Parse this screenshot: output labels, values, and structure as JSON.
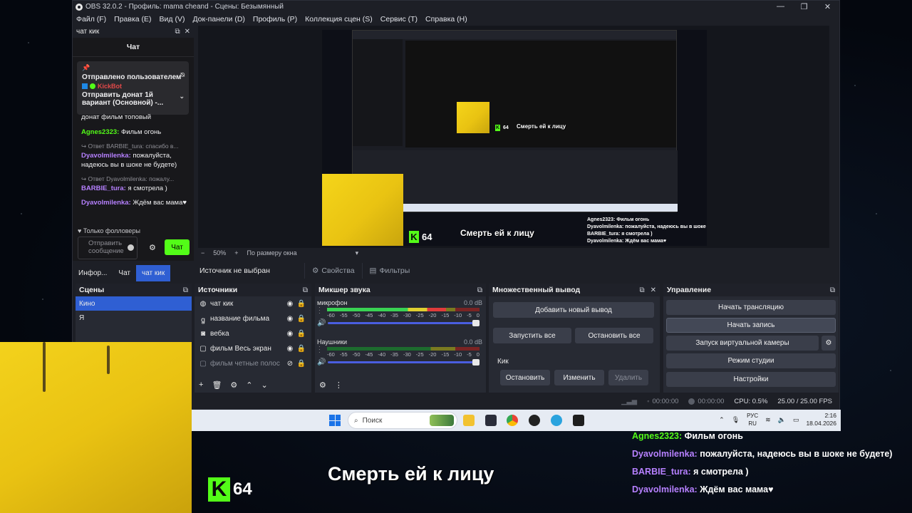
{
  "window": {
    "title": "OBS 32.0.2 - Профиль: mama cheand - Сцены: Безымянный",
    "controls": [
      "—",
      "❐",
      "✕"
    ]
  },
  "menu": [
    "Файл (F)",
    "Правка (E)",
    "Вид (V)",
    "Док-панели (D)",
    "Профиль (P)",
    "Коллекция сцен (S)",
    "Сервис (T)",
    "Справка (H)"
  ],
  "chat_dock": {
    "title": "чат кик",
    "header": "Чат",
    "pinned": {
      "by": "Отправлено пользователем",
      "user": "KickBot",
      "text1": "Отправить донат 1й",
      "text2": "вариант (Основной) -..."
    },
    "messages": [
      {
        "reply": "",
        "user": "",
        "text": "донат фильм топовый",
        "color": "none"
      },
      {
        "reply": "",
        "user": "Agnes2323:",
        "text": "Фильм огонь",
        "color": "green"
      },
      {
        "reply": "↪ Ответ BARBIE_tura: спасибо в...",
        "user": "Dyavolmilenka:",
        "text": "пожалуйста, надеюсь вы в шоке не будете)",
        "color": "purple"
      },
      {
        "reply": "↪ Ответ Dyavolmilenka: пожалу...",
        "user": "BARBIE_tura:",
        "text": "я смотрела )",
        "color": "purple"
      },
      {
        "reply": "",
        "user": "Dyavolmilenka:",
        "text": "Ждём вас мама♥",
        "color": "purple"
      }
    ],
    "followers_only": "♥ Только фолловеры",
    "input_placeholder": "Отправить сообщение",
    "send_label": "Чат",
    "tabs": [
      "Инфор...",
      "Чат",
      "чат кик"
    ]
  },
  "preview": {
    "overlay_title": "Смерть ей к лицу",
    "kick_count": "64",
    "zoom": "50%",
    "zoom_mode": "По размеру окна",
    "inner_chat": [
      "Agnes2323: Фильм огонь",
      "Dyavolmilenka: пожалуйста, надеюсь вы в шоке не будете)",
      "BARBIE_tura: я смотрела )",
      "Dyavolmilenka: Ждём вас мама♥"
    ]
  },
  "source_bar": {
    "label": "Источник не выбран",
    "properties": "Свойства",
    "filters": "Фильтры"
  },
  "scenes": {
    "title": "Сцены",
    "items": [
      "Кино",
      "Я"
    ]
  },
  "sources": {
    "title": "Источники",
    "items": [
      {
        "name": "чат кик",
        "icon": "🌐"
      },
      {
        "name": "название фильма",
        "icon": "⛭"
      },
      {
        "name": "вебка",
        "icon": "📷"
      },
      {
        "name": "фильм Весь экран",
        "icon": "▢"
      },
      {
        "name": "фильм четные полос",
        "icon": "▢"
      }
    ]
  },
  "mixer": {
    "title": "Микшер звука",
    "channels": [
      {
        "name": "микрофон",
        "db": "0.0 dB",
        "level": 0.78
      },
      {
        "name": "Наушники",
        "db": "0.0 dB",
        "level": 0.0
      }
    ],
    "scale": [
      "-60",
      "-55",
      "-50",
      "-45",
      "-40",
      "-35",
      "-30",
      "-25",
      "-20",
      "-15",
      "-10",
      "-5",
      "0"
    ]
  },
  "multi_output": {
    "title": "Множественный вывод",
    "add": "Добавить новый вывод",
    "start_all": "Запустить все",
    "stop_all": "Остановить все",
    "target": "Кик",
    "stop": "Остановить",
    "edit": "Изменить",
    "delete": "Удалить"
  },
  "controls": {
    "title": "Управление",
    "stream": "Начать трансляцию",
    "record": "Начать запись",
    "vcam": "Запуск виртуальной камеры",
    "studio": "Режим студии",
    "settings": "Настройки"
  },
  "status": {
    "stream_time": "00:00:00",
    "rec_time": "00:00:00",
    "cpu": "CPU: 0.5%",
    "fps": "25.00 / 25.00 FPS"
  },
  "taskbar": {
    "search": "Поиск",
    "lang1": "РУС",
    "lang2": "RU",
    "time": "2:16",
    "date": "18.04.2026"
  },
  "stream_overlay": {
    "title": "Смерть ей к лицу",
    "kick_count": "64",
    "chat": [
      {
        "user": "Agnes2323:",
        "text": "Фильм огонь",
        "color": "green"
      },
      {
        "user": "Dyavolmilenka:",
        "text": "пожалуйста, надеюсь вы в шоке не будете)",
        "color": "purple"
      },
      {
        "user": "BARBIE_tura:",
        "text": "я смотрела )",
        "color": "purple"
      },
      {
        "user": "Dyavolmilenka:",
        "text": "Ждём вас мама♥",
        "color": "purple"
      }
    ]
  },
  "colors": {
    "kick_green": "#53fc18",
    "accent_blue": "#2f5fd3",
    "chat_purple": "#b680ff"
  }
}
